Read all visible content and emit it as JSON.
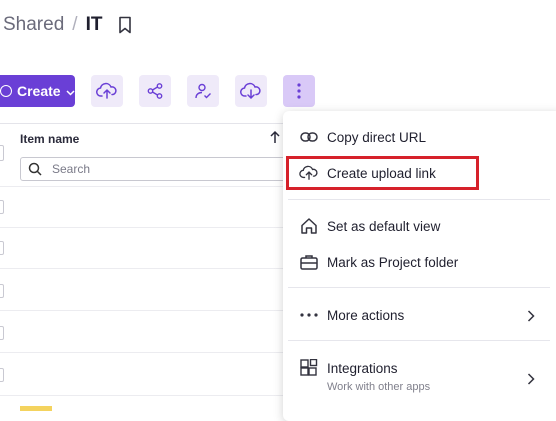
{
  "breadcrumb": {
    "parent": "Shared",
    "separator": "/",
    "current": "IT"
  },
  "toolbar": {
    "create_label": "Create",
    "tools": [
      "upload-cloud-icon",
      "share-icon",
      "user-check-icon",
      "download-cloud-icon",
      "more-vertical-icon"
    ]
  },
  "table": {
    "column_header": "Item name",
    "search_placeholder": "Search"
  },
  "menu": {
    "copy_url": "Copy direct URL",
    "create_upload": "Create upload link",
    "set_default": "Set as default view",
    "mark_project": "Mark as Project folder",
    "more_actions": "More actions",
    "integrations": "Integrations",
    "integrations_sub": "Work with other apps"
  },
  "colors": {
    "accent": "#6a3fd6",
    "highlight": "#d6212a",
    "tool_bg": "#efeaf9"
  }
}
